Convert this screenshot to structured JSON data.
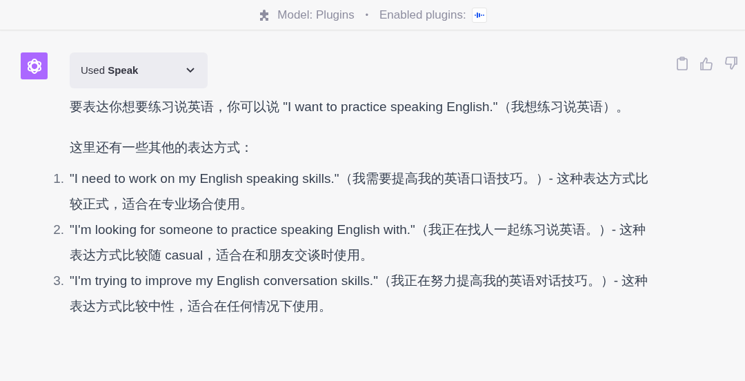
{
  "header": {
    "model": "Model: Plugins",
    "separator": "•",
    "enabled_label": "Enabled plugins:"
  },
  "message": {
    "plugin_toggle": {
      "label": "Used **Speak**",
      "expanded": false
    },
    "intro": "要表达你想要练习说英语，你可以说 \"I want to practice speaking English.\"（我想练习说英语）。",
    "lead_in": "这里还有一些其他的表达方式：",
    "items": [
      {
        "number": "1.",
        "text": "\"I need to work on my English speaking skills.\"（我需要提高我的英语口语技巧。）- 这种表达方式比较正式，适合在专业场合使用。"
      },
      {
        "number": "2.",
        "text": "\"I'm looking for someone to practice speaking English with.\"（我正在找人一起练习说英语。）- 这种表达方式比较随 casual，适合在和朋友交谈时使用。"
      },
      {
        "number": "3.",
        "text": "\"I'm trying to improve my English conversation skills.\"（我正在努力提高我的英语对话技巧。）- 这种表达方式比较中性，适合在任何情况下使用。"
      }
    ]
  }
}
